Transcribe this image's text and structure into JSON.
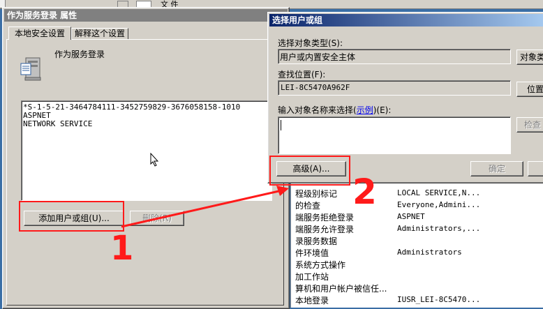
{
  "taskbar_fragment": "文 件",
  "props": {
    "title": "作为服务登录 属性",
    "tabs": [
      "本地安全设置",
      "解释这个设置"
    ],
    "policy_name": "作为服务登录",
    "accounts": [
      "*S-1-5-21-3464784111-3452759829-3676058158-1010",
      "ASPNET",
      "NETWORK SERVICE"
    ],
    "add_button": "添加用户或组(U)...",
    "remove_button": "删除(R)"
  },
  "dialog": {
    "title": "选择用户或组",
    "object_type_label": "选择对象类型(S):",
    "object_type_value": "用户或内置安全主体",
    "object_type_button": "对象类",
    "location_label": "查找位置(F):",
    "location_value": "LEI-8C5470A962F",
    "location_button": "位置",
    "names_label_prefix": "输入对象名称来选择(",
    "names_label_link": "示例",
    "names_label_suffix": ")(E):",
    "check_button": "检查",
    "advanced_button": "高级(A)...",
    "ok_button": "确定"
  },
  "background_policies": [
    {
      "name": "程级别标记",
      "value": "LOCAL SERVICE,N..."
    },
    {
      "name": "的检查",
      "value": "Everyone,Admini..."
    },
    {
      "name": "端服务拒绝登录",
      "value": "ASPNET"
    },
    {
      "name": "端服务允许登录",
      "value": "Administrators,..."
    },
    {
      "name": "录服务数据",
      "value": ""
    },
    {
      "name": "件环境值",
      "value": "Administrators"
    },
    {
      "name": "系统方式操作",
      "value": ""
    },
    {
      "name": "加工作站",
      "value": ""
    },
    {
      "name": "算机和用户帐户被信任...",
      "value": ""
    },
    {
      "name": "本地登录",
      "value": "IUSR_LEI-8C5470..."
    }
  ],
  "annotations": {
    "step1": "1",
    "step2": "2",
    "color": "#ff1a1a"
  }
}
